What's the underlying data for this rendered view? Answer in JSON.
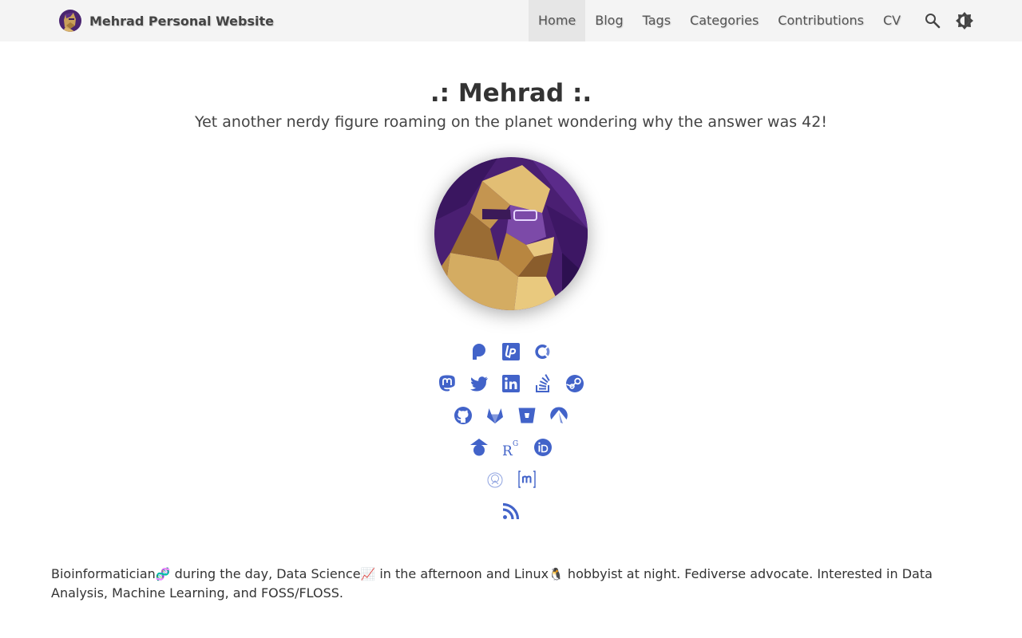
{
  "site": {
    "title": "Mehrad Personal Website"
  },
  "nav": {
    "items": [
      {
        "label": "Home"
      },
      {
        "label": "Blog"
      },
      {
        "label": "Tags"
      },
      {
        "label": "Categories"
      },
      {
        "label": "Contributions"
      },
      {
        "label": "CV"
      }
    ],
    "active": "Home",
    "search_icon": "search-icon",
    "theme_icon": "theme-toggle-icon"
  },
  "hero": {
    "title": ".: Mehrad :.",
    "subtitle": "Yet another nerdy figure roaming on the planet wondering why the answer was 42!"
  },
  "social": {
    "icon_color": "#4263c9",
    "rows": [
      [
        "patreon-icon",
        "liberapay-icon",
        "opencollective-icon"
      ],
      [
        "mastodon-icon",
        "twitter-icon",
        "linkedin-icon",
        "stackoverflow-icon",
        "steam-icon"
      ],
      [
        "github-icon",
        "gitlab-icon",
        "bitbucket-icon",
        "codeberg-icon"
      ],
      [
        "google-scholar-icon",
        "researchgate-icon",
        "orcid-icon"
      ],
      [
        "publons-icon",
        "matrix-icon"
      ],
      [
        "rss-icon"
      ]
    ]
  },
  "bio": {
    "part1": "Bioinformatician",
    "emoji1": "🧬",
    "part2": " during the day, Data Science",
    "emoji2": "📈",
    "part3": " in the afternoon and Linux",
    "emoji3": "🐧",
    "part4": " hobbyist at night. Fediverse advocate. Interested in Data Analysis, Machine Learning, and FOSS/FLOSS."
  }
}
